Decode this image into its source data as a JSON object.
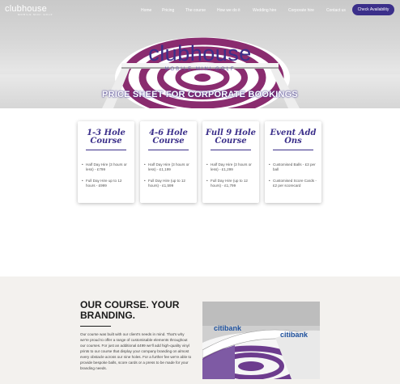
{
  "nav": {
    "logo": "clubhouse",
    "logo_sub": "MOBILE MINI GOLF",
    "items": [
      "Home",
      "Pricing",
      "The course",
      "How we do it",
      "Wedding hire",
      "Corporate hire",
      "Contact us"
    ],
    "cta": "Check Availability"
  },
  "hero": {
    "title": "clubhouse",
    "tagline": "MOBILE MINI GOLF",
    "subtitle": "PRICE SHEET FOR CORPORATE BOOKINGS"
  },
  "cards": [
    {
      "title_line1": "1-3 Hole",
      "title_line2": "Course",
      "items": [
        "Half Day Hire (3 hours or less) - £799",
        "Full Day Hire up to 12 hours - £999"
      ]
    },
    {
      "title_line1": "4-6 Hole",
      "title_line2": "Course",
      "items": [
        "Half Day Hire (3 hours or less) - £1,199",
        "Full Day Hire (up to 12 hours) - £1,599"
      ]
    },
    {
      "title_line1": "Full 9 Hole",
      "title_line2": "Course",
      "items": [
        "Half Day Hire (3 hours or less) - £1,299",
        "Full Day Hire (up to 12 hours) - £1,799"
      ]
    },
    {
      "title_line1": "Event Add",
      "title_line2": "Ons",
      "items": [
        "Customised Balls - £3 per ball",
        "Customised Score Cards - £2 per scorecard"
      ]
    }
  ],
  "branding": {
    "heading_line1": "OUR COURSE. YOUR",
    "heading_line2": "BRANDING.",
    "body": "Our course was built with our client's needs in mind. That's why we're proud to offer a range of customisable elements throughout our courses. For just an additional £499 we'll add high-quality vinyl prints to our course that display your company branding on almost every obstacle across our nine holes. For a further fee we're able to provide bespoke balls, score cards or a press to be made for your branding needs.",
    "photo_text": "citibank"
  },
  "colors": {
    "brand_purple": "#3b2f8a",
    "section_bg": "#f3f1ee"
  }
}
